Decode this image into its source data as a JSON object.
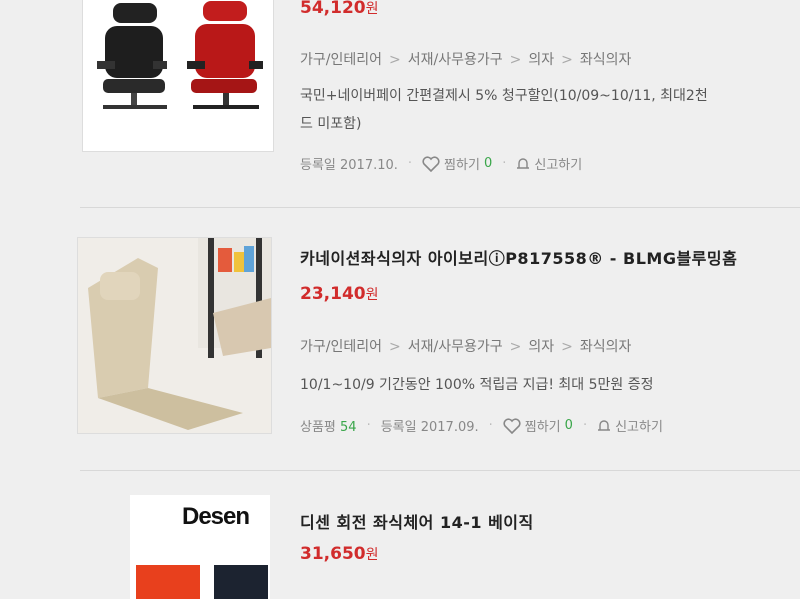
{
  "items": [
    {
      "price": "54,120",
      "price_unit": "원",
      "category": [
        "가구/인테리어",
        "서재/사무용가구",
        "의자",
        "좌식의자"
      ],
      "promo_line1": "국민+네이버페이 간편결제시 5% 청구할인(10/09~10/11, 최대2천",
      "promo_line2": "드 미포함)",
      "registered": "등록일 2017.10.",
      "wish_label": "찜하기",
      "wish_count": "0",
      "report_label": "신고하기"
    },
    {
      "title": "카네이션좌식의자 아이보리ⓘP817558® - BLMG블루밍홈",
      "price": "23,140",
      "price_unit": "원",
      "category": [
        "가구/인테리어",
        "서재/사무용가구",
        "의자",
        "좌식의자"
      ],
      "promo_line1": "10/1~10/9 기간동안 100% 적립금 지급! 최대 5만원 증정",
      "review_label": "상품평",
      "review_count": "54",
      "registered": "등록일 2017.09.",
      "wish_label": "찜하기",
      "wish_count": "0",
      "report_label": "신고하기"
    },
    {
      "brand_logo": "Desen",
      "title": "디센 회전 좌식체어 14-1 베이직",
      "price": "31,650",
      "price_unit": "원"
    }
  ],
  "colors": {
    "price": "#d12c2c",
    "count": "#3aa64a",
    "title": "#222222"
  },
  "icons": [
    "heart-icon",
    "bell-icon"
  ]
}
